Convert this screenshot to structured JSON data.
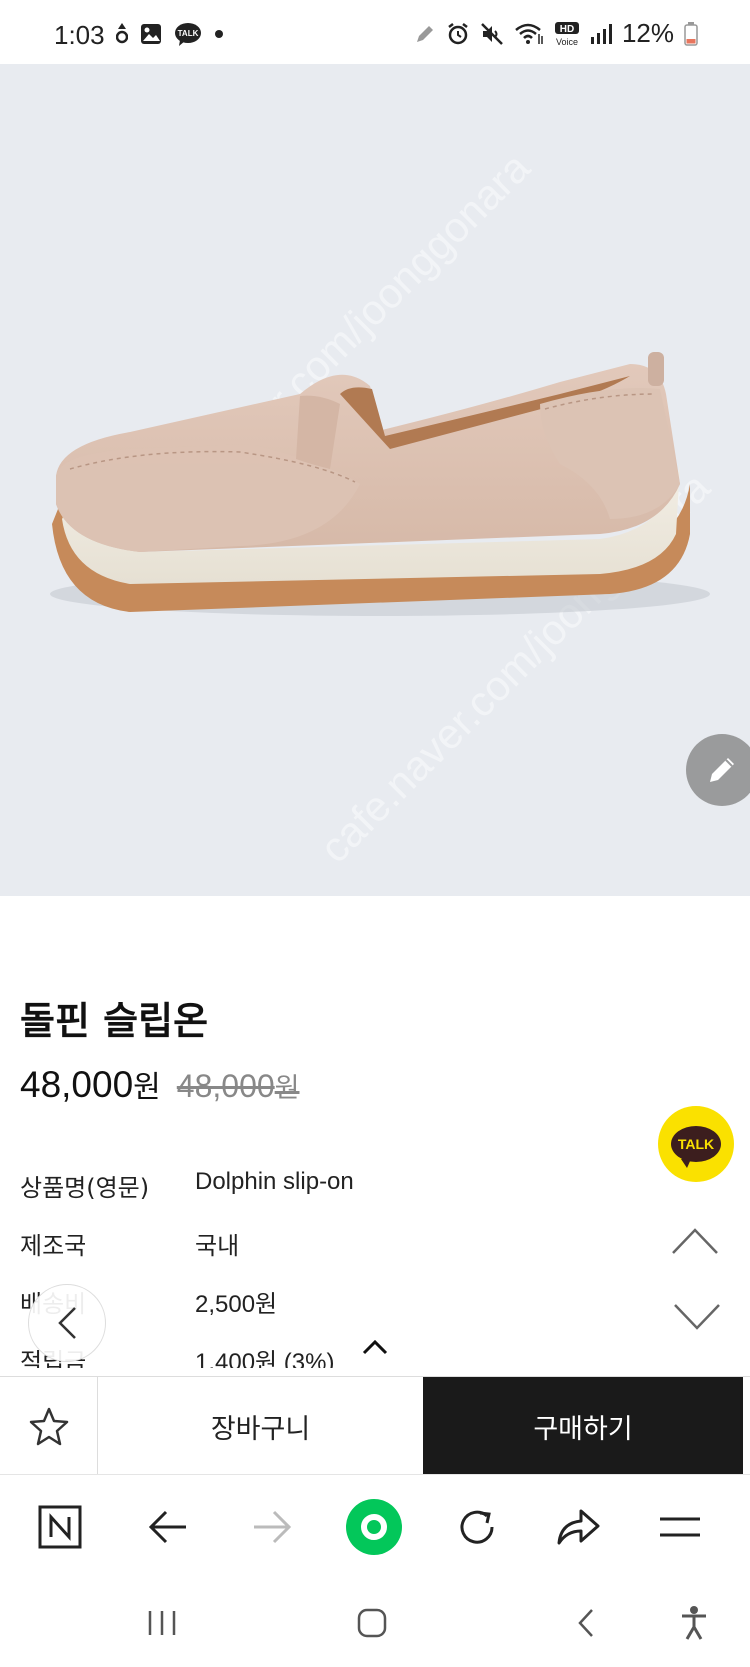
{
  "status_bar": {
    "time": "1:03",
    "talk_badge": "TALK",
    "hd_voice": "HD\nVoice",
    "battery": "12%",
    "icons": [
      "location-pin-icon",
      "gallery-icon",
      "kakaotalk-icon",
      "dot-icon",
      "pen-icon",
      "alarm-icon",
      "mute-icon",
      "wifi-icon",
      "hd-voice-icon",
      "signal-icon",
      "battery-icon"
    ]
  },
  "product_image": {
    "watermark": "cafe.naver.com/joonggonara",
    "edit_button_icon": "pencil-icon"
  },
  "product": {
    "title": "돌핀 슬립온",
    "price_number": "48,000",
    "price_unit": "원",
    "original_price_number": "48,000",
    "original_price_unit": "원"
  },
  "details": [
    {
      "label": "상품명(영문)",
      "value": "Dolphin slip-on"
    },
    {
      "label": "제조국",
      "value": "국내"
    },
    {
      "label": "배송비",
      "value": "2,500원"
    },
    {
      "label": "적립금",
      "value": "1,400원 (3%)"
    }
  ],
  "floating": {
    "talk_label": "TALK"
  },
  "purchase_bar": {
    "cart_label": "장바구니",
    "buy_label": "구매하기",
    "accent": "#1a1a1a"
  },
  "browser_toolbar": {
    "items": [
      "naver-n-icon",
      "back-arrow-icon",
      "forward-arrow-icon",
      "green-home-icon",
      "refresh-icon",
      "share-icon",
      "menu-icon"
    ],
    "home_color": "#03c75a"
  },
  "system_nav": {
    "items": [
      "recents-icon",
      "home-icon",
      "back-icon",
      "accessibility-icon"
    ]
  }
}
